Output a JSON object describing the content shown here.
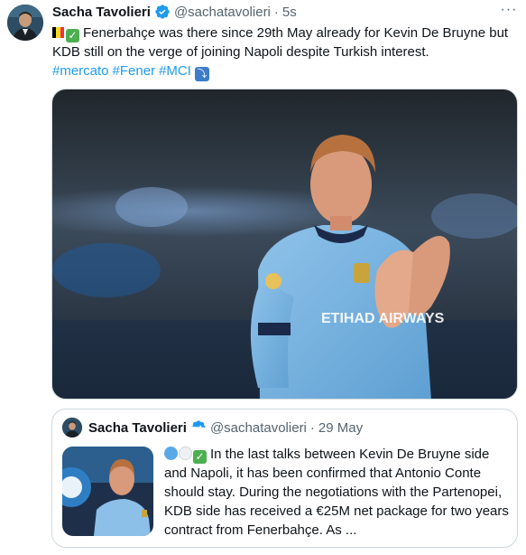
{
  "tweet": {
    "author_name": "Sacha Tavolieri",
    "handle": "@sachatavolieri",
    "separator": "·",
    "time": "5s",
    "more_label": "···",
    "text": "Fenerbahçe was there since 29th May already for Kevin De Bruyne but KDB still on the verge of joining Napoli despite Turkish interest.",
    "hashtags": [
      "#mercato",
      "#Fener",
      "#MCI"
    ],
    "media_alt": "Kevin De Bruyne applauding in a light-blue jersey",
    "jersey_text": "ETIHAD AIRWAYS"
  },
  "quoted_tweet": {
    "author_name": "Sacha Tavolieri",
    "handle": "@sachatavolieri",
    "separator": "·",
    "date": "29 May",
    "text": "In the last talks between Kevin De Bruyne side and Napoli, it has been confirmed that Antonio Conte should stay. During the negotiations with the Partenopei, KDB side has received a €25M net package for two years contract from Fenerbahçe. As ..."
  },
  "colors": {
    "link": "#1d9bf0",
    "verified": "#1d9bf0",
    "muted": "#536471",
    "border": "#cfd9de"
  },
  "icons": [
    "verified-badge-icon",
    "belgium-flag-icon",
    "check-mark-icon",
    "arrow-down-right-icon",
    "blue-circle-icon",
    "white-circle-icon",
    "more-icon"
  ]
}
